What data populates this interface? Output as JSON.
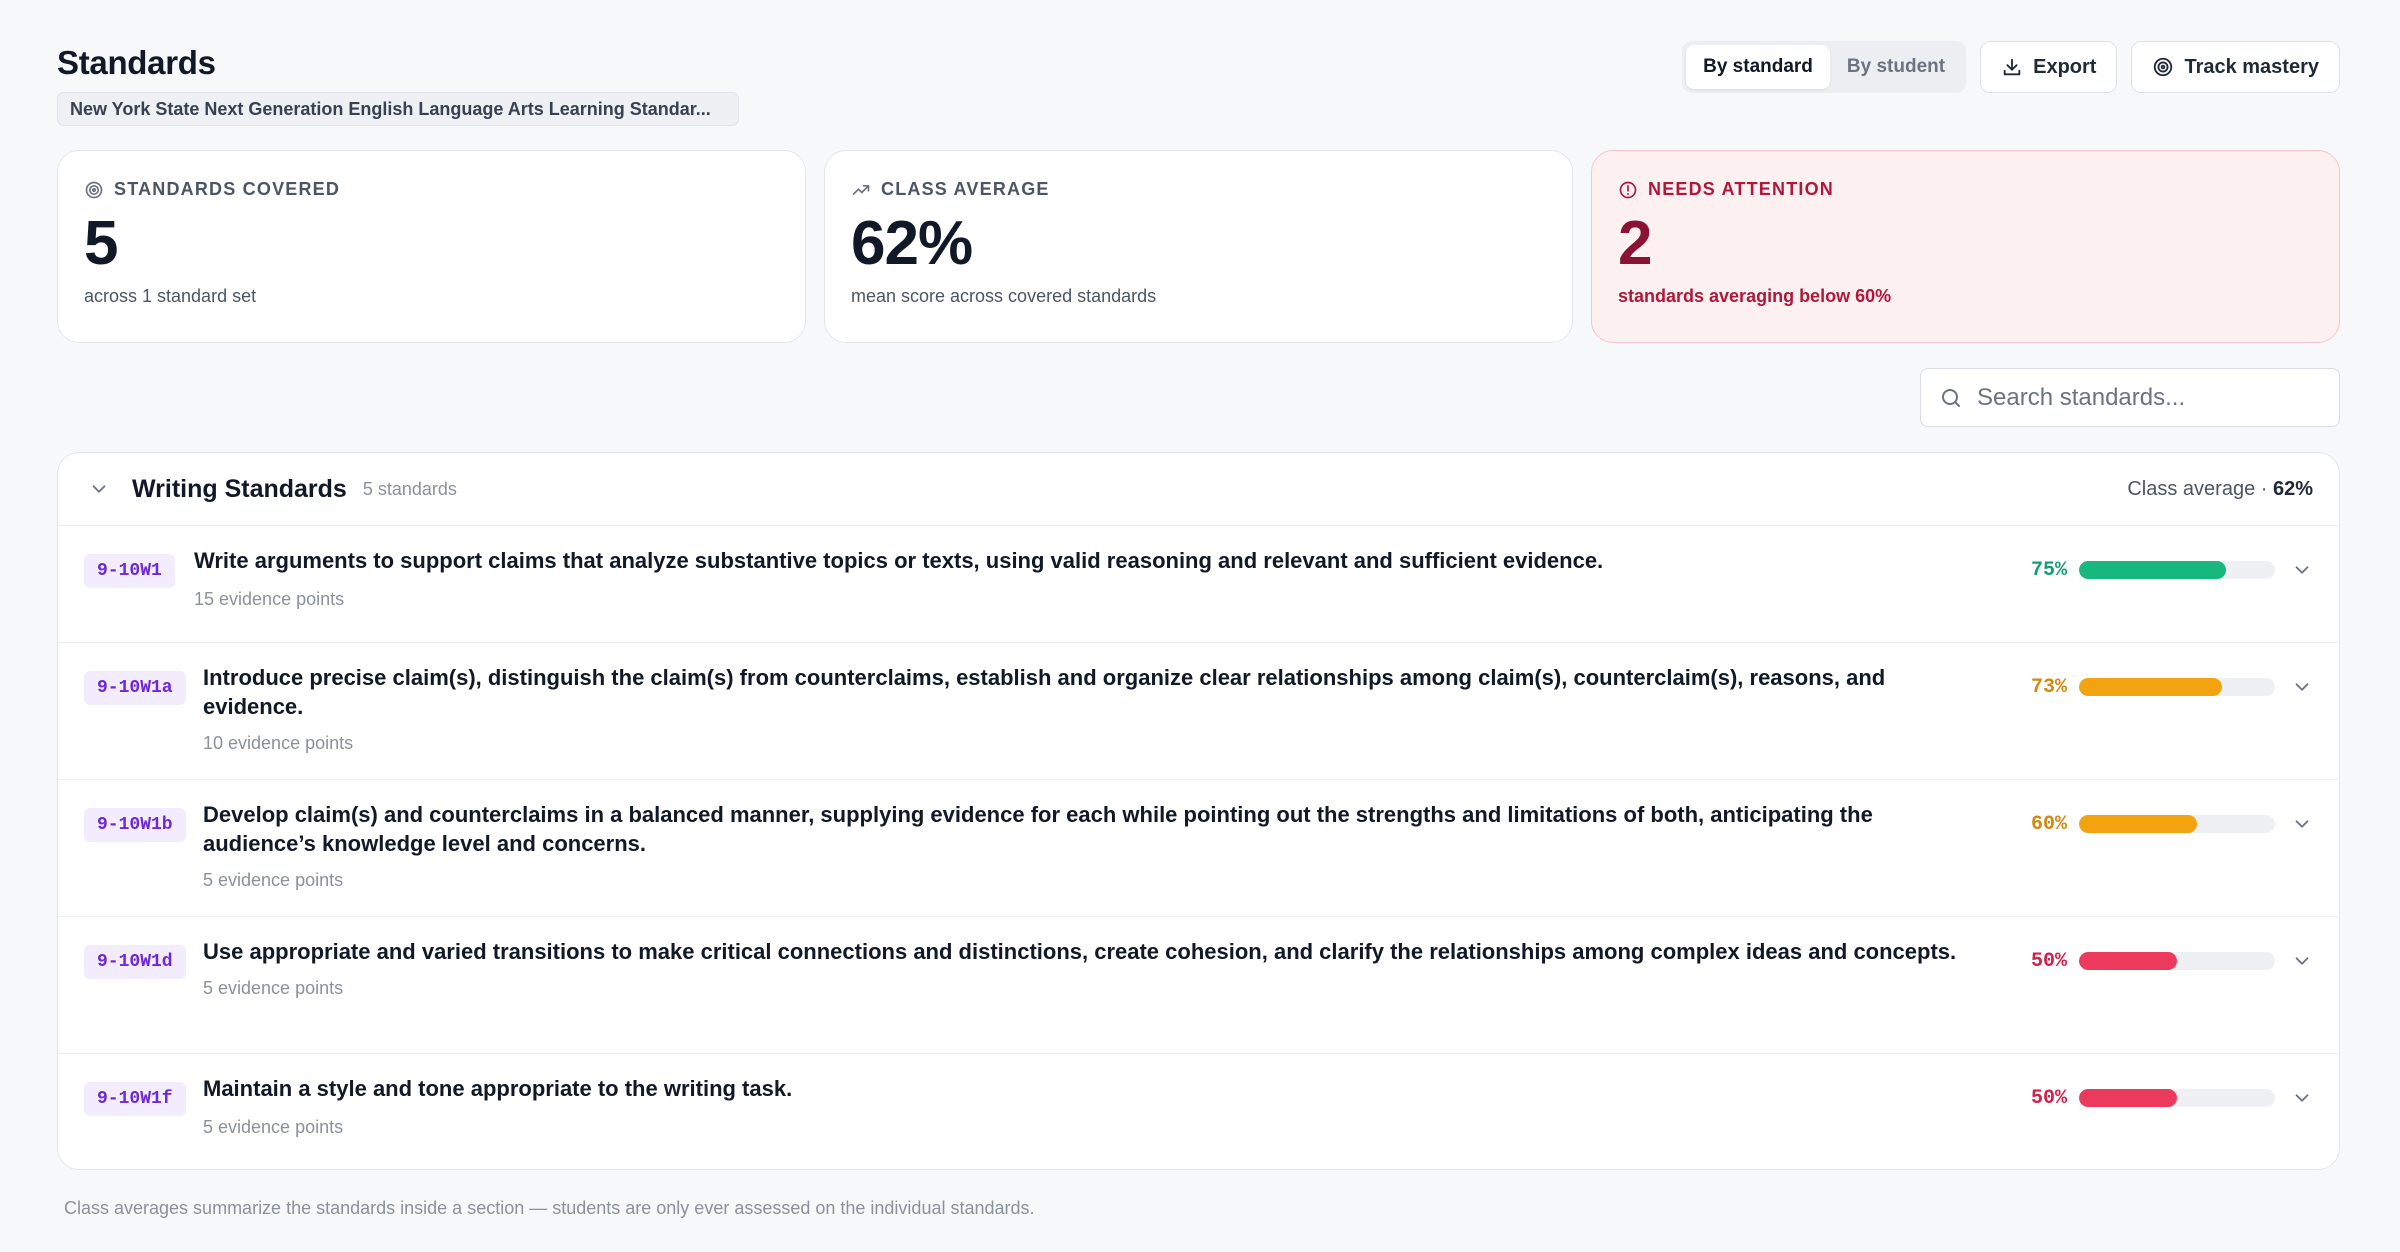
{
  "header": {
    "title": "Standards",
    "standard_set": "New York State Next Generation English Language Arts Learning Standar...",
    "view_toggle": {
      "by_standard": "By standard",
      "by_student": "By student",
      "active": "by_standard"
    },
    "export_label": "Export",
    "track_label": "Track mastery"
  },
  "stats": [
    {
      "label": "Standards covered",
      "value": "5",
      "sub": "across 1 standard set",
      "icon": "target-icon"
    },
    {
      "label": "Class average",
      "value": "62%",
      "sub": "mean score across covered standards",
      "icon": "trend-up-icon"
    },
    {
      "label": "Needs attention",
      "value": "2",
      "sub": "standards averaging below 60%",
      "icon": "alert-circle-icon"
    }
  ],
  "search": {
    "placeholder": "Search standards..."
  },
  "section": {
    "title": "Writing Standards",
    "count": "5 standards",
    "average_label": "Class average · ",
    "average_value": "62%"
  },
  "standards": [
    {
      "code": "9-10W1",
      "description": "Write arguments to support claims that analyze substantive topics or texts, using valid reasoning and relevant and sufficient evidence.",
      "evidence": "15 evidence points",
      "percent": 75,
      "percent_label": "75%",
      "color": "#17b77e",
      "text_color": "#0f9f6e"
    },
    {
      "code": "9-10W1a",
      "description": "Introduce precise claim(s), distinguish the claim(s) from counterclaims, establish and organize clear relationships among claim(s), counterclaim(s), reasons, and evidence.",
      "evidence": "10 evidence points",
      "percent": 73,
      "percent_label": "73%",
      "color": "#f2a30f",
      "text_color": "#d4870b"
    },
    {
      "code": "9-10W1b",
      "description": "Develop claim(s) and counterclaims in a balanced manner, supplying evidence for each while pointing out the strengths and limitations of both, anticipating the audience’s knowledge level and concerns.",
      "evidence": "5 evidence points",
      "percent": 60,
      "percent_label": "60%",
      "color": "#f2a30f",
      "text_color": "#d4870b"
    },
    {
      "code": "9-10W1d",
      "description": "Use appropriate and varied transitions to make critical connections and distinctions, create cohesion, and clarify the relationships among complex ideas and concepts.",
      "evidence": "5 evidence points",
      "percent": 50,
      "percent_label": "50%",
      "color": "#ec3a5c",
      "text_color": "#d41f47"
    },
    {
      "code": "9-10W1f",
      "description": "Maintain a style and tone appropriate to the writing task.",
      "evidence": "5 evidence points",
      "percent": 50,
      "percent_label": "50%",
      "color": "#ec3a5c",
      "text_color": "#d41f47"
    }
  ],
  "footnote": "Class averages summarize the standards inside a section — students are only ever assessed on the individual standards."
}
